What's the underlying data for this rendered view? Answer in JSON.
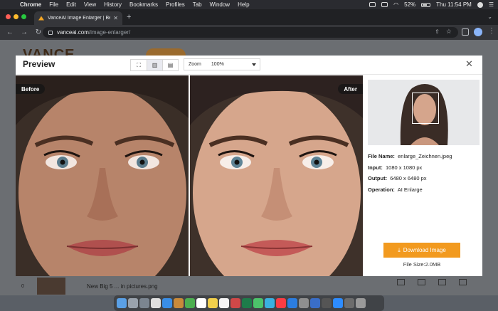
{
  "menubar": {
    "app": "Chrome",
    "items": [
      "File",
      "Edit",
      "View",
      "History",
      "Bookmarks",
      "Profiles",
      "Tab",
      "Window",
      "Help"
    ],
    "battery": "52%",
    "clock": "Thu 11:54 PM"
  },
  "browser": {
    "tab_title": "VanceAI Image Enlarger | Best",
    "url_host": "vanceai.com",
    "url_path": "/image-enlarger/"
  },
  "background_page": {
    "logo": "VANCE",
    "row_number": "0",
    "row_name": "New Big 5 ... in pictures.png"
  },
  "modal": {
    "title": "Preview",
    "zoom_label": "Zoom",
    "zoom_value": "100%",
    "before_label": "Before",
    "after_label": "After",
    "info": {
      "file_name_label": "File Name:",
      "file_name": "enlarge_Zeichnen.jpeg",
      "input_label": "Input:",
      "input": "1080 x 1080 px",
      "output_label": "Output:",
      "output": "6480 x 6480 px",
      "operation_label": "Operation:",
      "operation": "AI Enlarge"
    },
    "download_label": "Download Image",
    "file_size": "File Size:2.0MB"
  },
  "colors": {
    "accent": "#f29a1f",
    "menubar": "#2a2b30",
    "browser_chrome": "#35363a"
  }
}
